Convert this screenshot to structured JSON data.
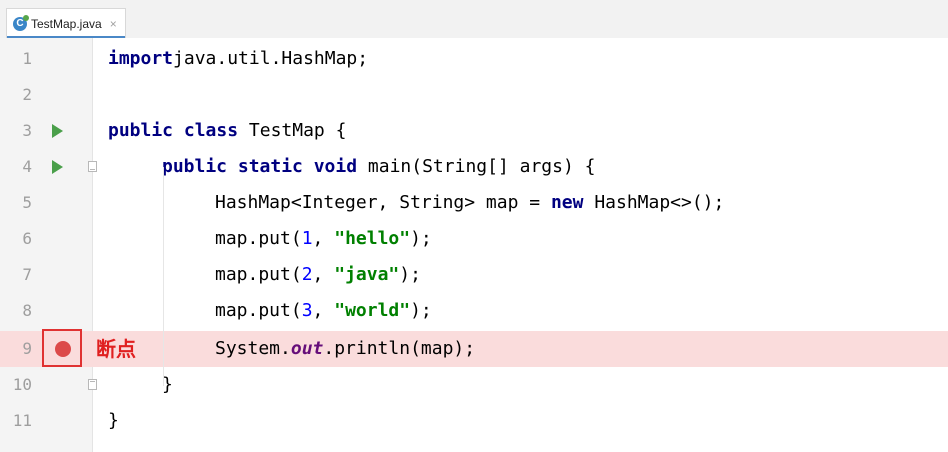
{
  "tab": {
    "filename": "TestMap.java",
    "icon_letter": "C",
    "close_glyph": "×"
  },
  "gutter": {
    "breakpoint_label": "断点"
  },
  "lines": [
    {
      "num": "1",
      "tokens": [
        [
          "kw",
          "import"
        ],
        [
          "",
          "java.util.HashMap;"
        ]
      ]
    },
    {
      "num": "2",
      "tokens": []
    },
    {
      "num": "3",
      "tokens": [
        [
          "kw",
          "public class "
        ],
        [
          "",
          "TestMap {"
        ]
      ]
    },
    {
      "num": "4",
      "tokens": [
        [
          "kw",
          "public static void "
        ],
        [
          "",
          "main(String[] args) {"
        ]
      ]
    },
    {
      "num": "5",
      "tokens": [
        [
          "",
          "HashMap<Integer, String> map = "
        ],
        [
          "kw",
          "new "
        ],
        [
          "",
          "HashMap<>();"
        ]
      ]
    },
    {
      "num": "6",
      "tokens": [
        [
          "",
          "map.put("
        ],
        [
          "num",
          "1"
        ],
        [
          "",
          ", "
        ],
        [
          "str",
          "\"hello\""
        ],
        [
          "",
          ");"
        ]
      ]
    },
    {
      "num": "7",
      "tokens": [
        [
          "",
          "map.put("
        ],
        [
          "num",
          "2"
        ],
        [
          "",
          ", "
        ],
        [
          "str",
          "\"java\""
        ],
        [
          "",
          ");"
        ]
      ]
    },
    {
      "num": "8",
      "tokens": [
        [
          "",
          "map.put("
        ],
        [
          "num",
          "3"
        ],
        [
          "",
          ", "
        ],
        [
          "str",
          "\"world\""
        ],
        [
          "",
          ");"
        ]
      ]
    },
    {
      "num": "9",
      "tokens": [
        [
          "",
          "System."
        ],
        [
          "fld",
          "out"
        ],
        [
          "",
          ".println(map);"
        ]
      ]
    },
    {
      "num": "10",
      "tokens": [
        [
          "",
          "}"
        ]
      ]
    },
    {
      "num": "11",
      "tokens": [
        [
          "",
          "}"
        ]
      ]
    }
  ]
}
